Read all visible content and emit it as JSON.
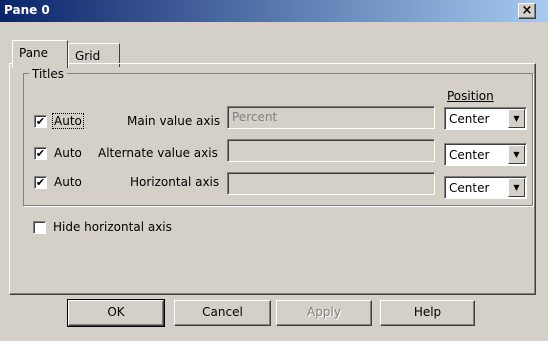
{
  "window": {
    "title": "Pane 0",
    "close_label": "×"
  },
  "tabs": [
    {
      "label": "Pane",
      "active": true
    },
    {
      "label": "Grid",
      "active": false
    }
  ],
  "titles_group": {
    "label": "Titles",
    "position_header": "Position",
    "rows": [
      {
        "auto_label": "Auto",
        "checked": true,
        "checkmark": "✔",
        "axis_label": "Main value axis",
        "value": "Percent",
        "position": "Center"
      },
      {
        "auto_label": "Auto",
        "checked": true,
        "checkmark": "✔",
        "axis_label": "Alternate value axis",
        "value": "",
        "position": "Center"
      },
      {
        "auto_label": "Auto",
        "checked": true,
        "checkmark": "✔",
        "axis_label": "Horizontal axis",
        "value": "",
        "position": "Center"
      }
    ],
    "dropdown_arrow": "▼"
  },
  "hide_horizontal_axis": {
    "label": "Hide horizontal axis",
    "checked": false
  },
  "buttons": {
    "ok": "OK",
    "cancel": "Cancel",
    "apply": "Apply",
    "help": "Help"
  }
}
